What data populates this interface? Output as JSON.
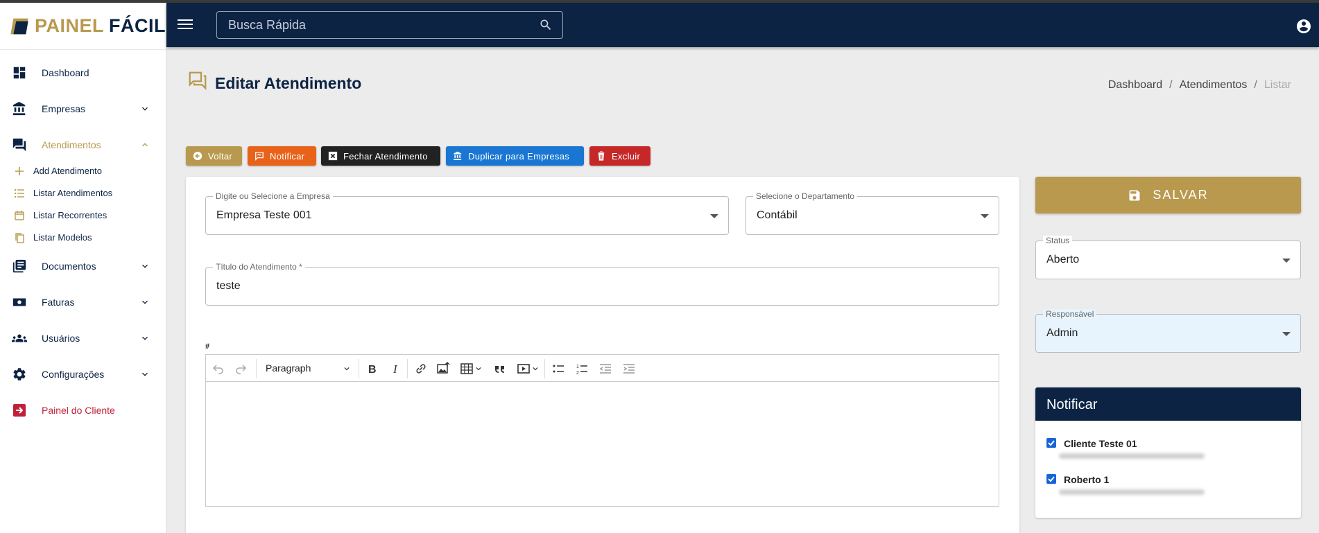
{
  "brand": {
    "part1": "PAINEL",
    "part2": "FÁCIL",
    "gold": "#b8994e",
    "navy": "#0c2344"
  },
  "search": {
    "placeholder": "Busca Rápida"
  },
  "sidebar": {
    "items": [
      {
        "label": "Dashboard",
        "icon": "dashboard-icon"
      },
      {
        "label": "Empresas",
        "icon": "bank-icon"
      },
      {
        "label": "Atendimentos",
        "icon": "forum-icon"
      },
      {
        "label": "Documentos",
        "icon": "document-icon"
      },
      {
        "label": "Faturas",
        "icon": "money-icon"
      },
      {
        "label": "Usuários",
        "icon": "users-icon"
      },
      {
        "label": "Configurações",
        "icon": "gear-icon"
      },
      {
        "label": "Painel do Cliente",
        "icon": "exit-icon"
      }
    ],
    "sub": [
      {
        "label": "Add Atendimento",
        "icon": "plus-icon"
      },
      {
        "label": "Listar Atendimentos",
        "icon": "list-icon"
      },
      {
        "label": "Listar Recorrentes",
        "icon": "calendar-icon"
      },
      {
        "label": "Listar Modelos",
        "icon": "copy-icon"
      }
    ]
  },
  "page": {
    "title": "Editar Atendimento",
    "breadcrumb": [
      "Dashboard",
      "Atendimentos",
      "Listar"
    ]
  },
  "actions": {
    "voltar": "Voltar",
    "notificar": "Notificar",
    "fechar": "Fechar Atendimento",
    "duplicar": "Duplicar para Empresas",
    "excluir": "Excluir"
  },
  "form": {
    "empresa": {
      "label": "Digite ou Selecione a Empresa",
      "value": "Empresa Teste 001"
    },
    "departamento": {
      "label": "Selecione o Departamento",
      "value": "Contábil"
    },
    "titulo": {
      "label": "Título do Atendimento *",
      "value": "teste"
    },
    "hash": "#",
    "editor": {
      "paragraph": "Paragraph"
    }
  },
  "side": {
    "save": "SALVAR",
    "status": {
      "label": "Status",
      "value": "Aberto"
    },
    "responsavel": {
      "label": "Responsável",
      "value": "Admin"
    },
    "notify": {
      "title": "Notificar",
      "people": [
        {
          "name": "Cliente Teste 01",
          "checked": true
        },
        {
          "name": "Roberto 1",
          "checked": true
        }
      ]
    }
  }
}
